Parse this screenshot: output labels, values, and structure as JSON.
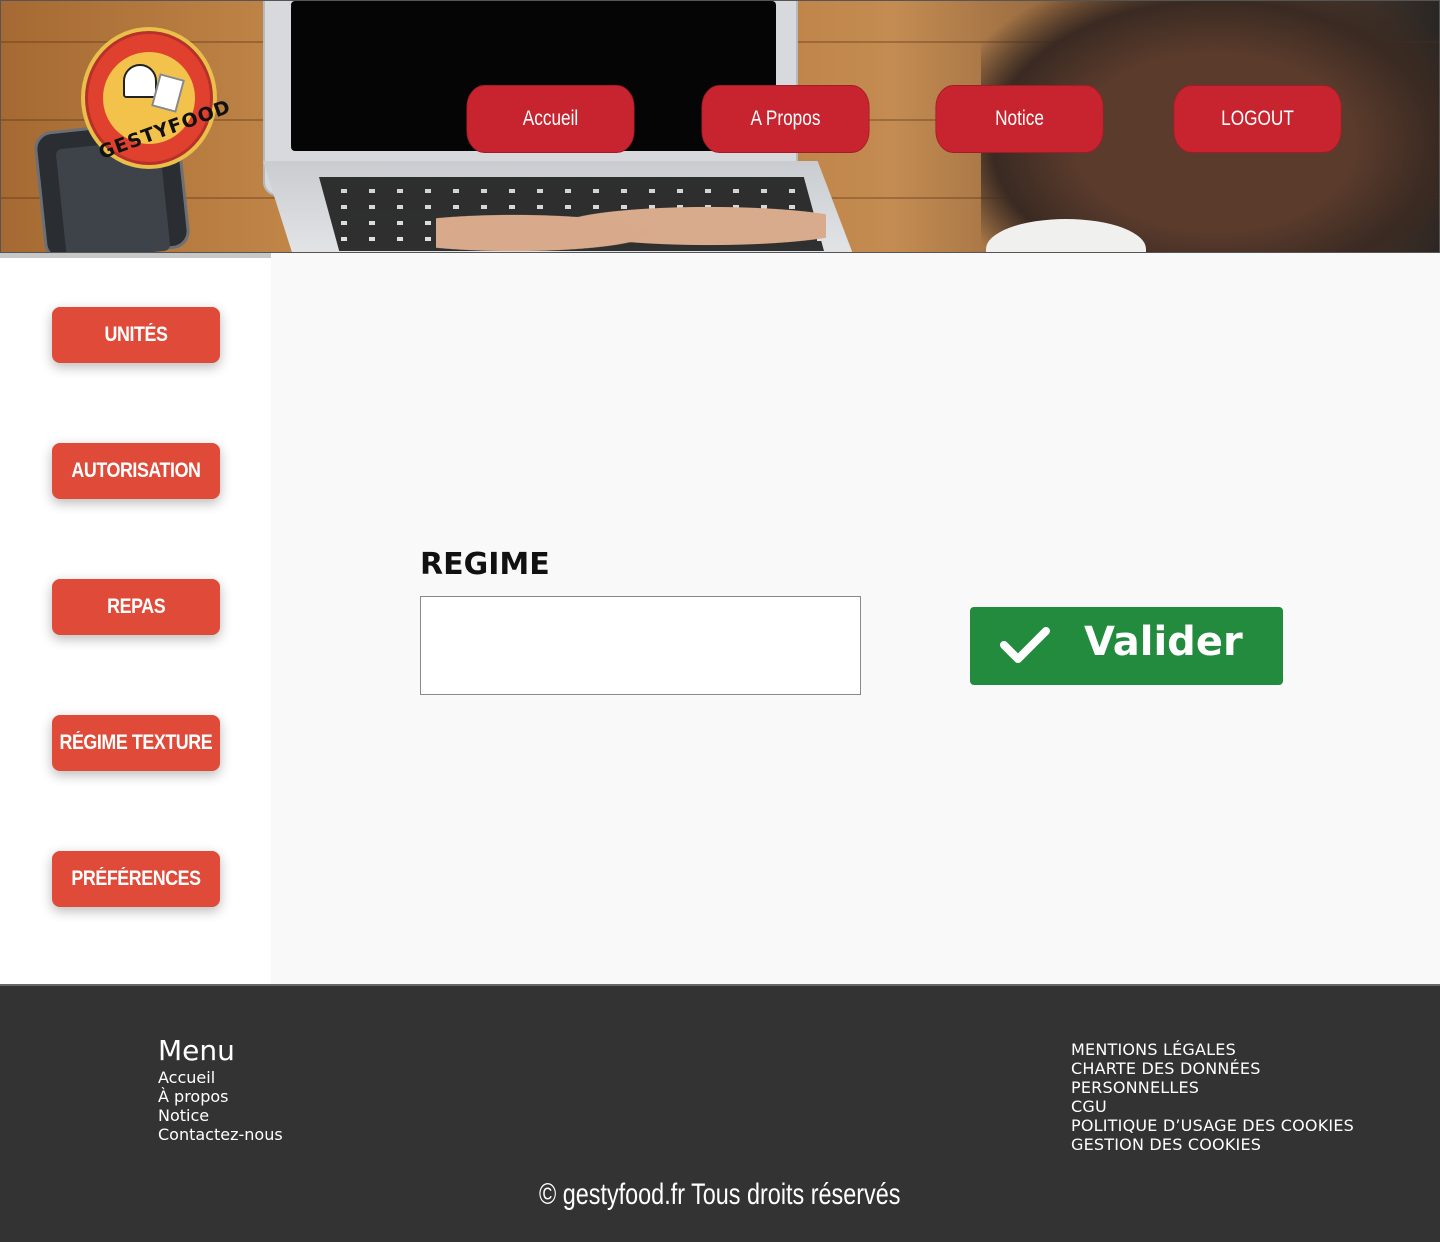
{
  "header": {
    "logo_text": "GESTYFOOD",
    "nav": [
      {
        "label": "Accueil"
      },
      {
        "label": "A Propos"
      },
      {
        "label": "Notice"
      },
      {
        "label": "LOGOUT"
      }
    ]
  },
  "sidebar": {
    "items": [
      {
        "label": "UNITÉS"
      },
      {
        "label": "AUTORISATION"
      },
      {
        "label": "REPAS"
      },
      {
        "label": "RÉGIME TEXTURE"
      },
      {
        "label": "PRÉFÉRENCES"
      }
    ]
  },
  "form": {
    "field_label": "REGIME",
    "field_value": "",
    "submit_label": "Valider",
    "submit_icon": "check-icon"
  },
  "footer": {
    "menu_title": "Menu",
    "menu_links": [
      "Accueil",
      "À propos",
      "Notice",
      "Contactez-nous"
    ],
    "legal_links": [
      "MENTIONS LÉGALES",
      "CHARTE DES DONNÉES",
      "PERSONNELLES",
      "CGU",
      "POLITIQUE D’USAGE DES COOKIES",
      "GESTION DES COOKIES"
    ],
    "copyright": "© gestyfood.fr  Tous droits réservés"
  },
  "colors": {
    "nav_button": "#c8242f",
    "sidebar_button": "#e04a38",
    "submit_button": "#228b3d",
    "footer_bg": "#333333",
    "main_bg": "#f9f9f9"
  }
}
